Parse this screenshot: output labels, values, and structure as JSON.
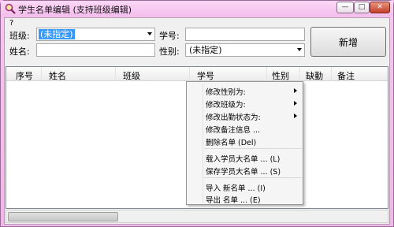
{
  "window": {
    "title": "学生名单编辑 (支持班级编辑)",
    "min_glyph": "—",
    "max_glyph": "□",
    "close_glyph": "✕"
  },
  "help_mark": "?",
  "form": {
    "class_label": "班级:",
    "class_value": "(未指定)",
    "student_no_label": "学号:",
    "student_no_value": "",
    "name_label": "姓名:",
    "name_value": "",
    "gender_label": "性别:",
    "gender_value": "(未指定)",
    "add_button": "新增"
  },
  "table": {
    "columns": [
      "序号",
      "姓名",
      "班级",
      "学号",
      "性别",
      "缺勤",
      "备注"
    ],
    "rows": []
  },
  "context_menu": {
    "items": [
      {
        "label": "修改性别为:",
        "submenu": true
      },
      {
        "label": "修改班级为:",
        "submenu": true
      },
      {
        "label": "修改出勤状态为:",
        "submenu": true
      },
      {
        "label": "修改备注信息 ...",
        "submenu": false
      },
      {
        "label": "删除名单 (Del)",
        "submenu": false
      },
      {
        "label": "载入学员大名单 ... (L)",
        "submenu": false
      },
      {
        "label": "保存学员大名单 ... (S)",
        "submenu": false
      },
      {
        "label": "导入 新名单 ... (I)",
        "submenu": false
      },
      {
        "label": "导出 名单 ... (E)",
        "submenu": false
      }
    ]
  },
  "colors": {
    "frame": "#f2b8ec",
    "selection": "#3399ff"
  }
}
